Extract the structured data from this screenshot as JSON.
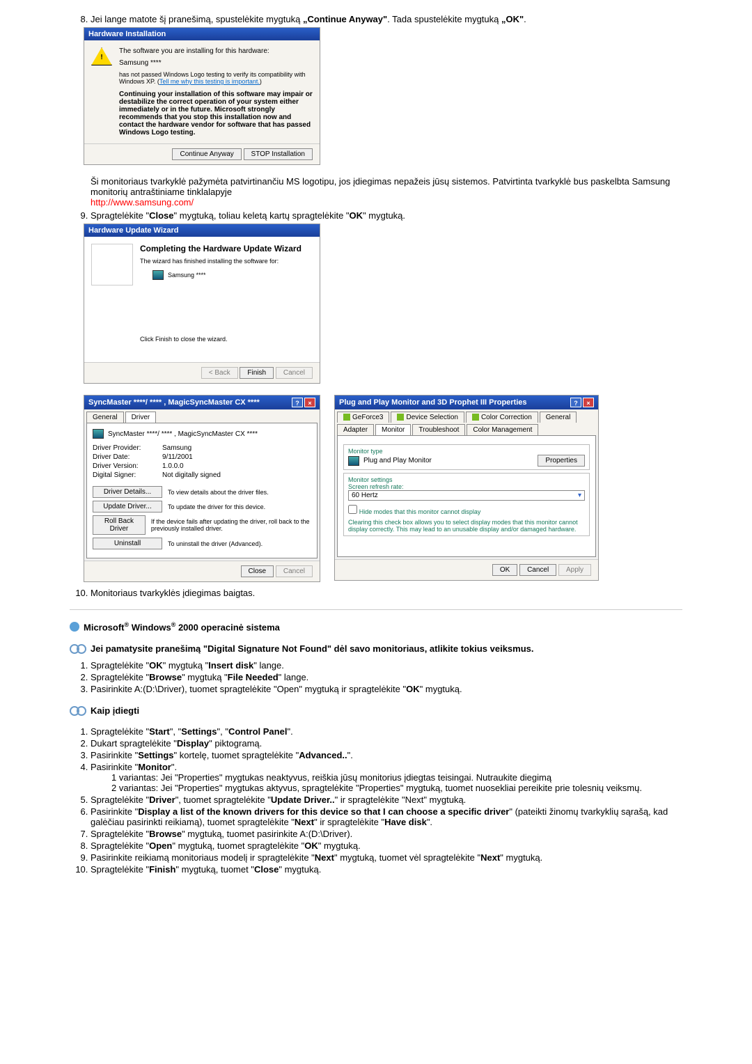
{
  "step8": {
    "num": "8.",
    "text_a": "Jei lange matote šį pranešimą, spustelėkite mygtuką ",
    "continue_anyway": "„Continue Anyway\"",
    "text_b": ". Tada spustelėkite mygtuką ",
    "ok": "„OK\"",
    "dot": "."
  },
  "dlg1": {
    "title": "Hardware Installation",
    "line1": "The software you are installing for this hardware:",
    "device": "Samsung ****",
    "line2a": "has not passed Windows Logo testing to verify its compatibility with Windows XP. (",
    "tell_me": "Tell me why this testing is important.",
    "line2b": ")",
    "warn": "Continuing your installation of this software may impair or destabilize the correct operation of your system either immediately or in the future. Microsoft strongly recommends that you stop this installation now and contact the hardware vendor for software that has passed Windows Logo testing.",
    "btn_continue": "Continue Anyway",
    "btn_stop": "STOP Installation"
  },
  "para1": {
    "a": "Ši monitoriaus tvarkyklė pažymėta patvirtinančiu MS logotipu, jos įdiegimas nepažeis jūsų sistemos. Patvirtinta tvarkyklė bus paskelbta Samsung monitorių antraštiniame tinklalapyje",
    "link": "http://www.samsung.com/"
  },
  "step9": {
    "num": "9.",
    "a": "Spragtelėkite \"",
    "close": "Close",
    "b": "\" mygtuką, toliau keletą kartų spragtelėkite \"",
    "ok": "OK",
    "c": "\" mygtuką."
  },
  "dlg2": {
    "title": "Hardware Update Wizard",
    "h1": "Completing the Hardware Update Wizard",
    "t1": "The wizard has finished installing the software for:",
    "dev": "Samsung ****",
    "t2": "Click Finish to close the wizard.",
    "back": "< Back",
    "finish": "Finish",
    "cancel": "Cancel"
  },
  "dlg3": {
    "title": "SyncMaster ****/ **** , MagicSyncMaster CX ****",
    "tab_general": "General",
    "tab_driver": "Driver",
    "header": "SyncMaster ****/ **** , MagicSyncMaster CX ****",
    "provider_l": "Driver Provider:",
    "provider_v": "Samsung",
    "date_l": "Driver Date:",
    "date_v": "9/11/2001",
    "ver_l": "Driver Version:",
    "ver_v": "1.0.0.0",
    "sign_l": "Digital Signer:",
    "sign_v": "Not digitally signed",
    "b_details": "Driver Details...",
    "b_details_d": "To view details about the driver files.",
    "b_update": "Update Driver...",
    "b_update_d": "To update the driver for this device.",
    "b_roll": "Roll Back Driver",
    "b_roll_d": "If the device fails after updating the driver, roll back to the previously installed driver.",
    "b_unin": "Uninstall",
    "b_unin_d": "To uninstall the driver (Advanced).",
    "close": "Close",
    "cancel": "Cancel"
  },
  "dlg4": {
    "title": "Plug and Play Monitor and 3D Prophet III Properties",
    "tabs": {
      "gf3": "GeForce3",
      "devsel": "Device Selection",
      "cc": "Color Correction",
      "gen": "General",
      "adap": "Adapter",
      "mon": "Monitor",
      "trbl": "Troubleshoot",
      "cmgmt": "Color Management"
    },
    "montype": "Monitor type",
    "monname": "Plug and Play Monitor",
    "props": "Properties",
    "monset": "Monitor settings",
    "refresh_l": "Screen refresh rate:",
    "refresh_v": "60 Hertz",
    "hide": "Hide modes that this monitor cannot display",
    "hint": "Clearing this check box allows you to select display modes that this monitor cannot display correctly. This may lead to an unusable display and/or damaged hardware.",
    "ok": "OK",
    "cancel": "Cancel",
    "apply": "Apply"
  },
  "step10": {
    "num": "10.",
    "t": "Monitoriaus tvarkyklės įdiegimas baigtas."
  },
  "section2": {
    "title_a": "Microsoft",
    "title_b": " Windows",
    "title_c": " 2000 operacinė sistema",
    "reg": "®"
  },
  "subhead1": {
    "a": "Jei pamatysite pranešimą \"Digital Signature Not Found\" dėl savo monitoriaus, atlikite tokius veiksmus."
  },
  "list1": {
    "i1a": "Spragtelėkite \"",
    "i1b": "OK",
    "i1c": "\" mygtuką \"",
    "i1d": "Insert disk",
    "i1e": "\" lange.",
    "i2a": "Spragtelėkite \"",
    "i2b": "Browse",
    "i2c": "\" mygtuką \"",
    "i2d": "File Needed",
    "i2e": "\" lange.",
    "i3a": "Pasirinkite A:(D:\\Driver), tuomet spragtelėkite \"Open\" mygtuką ir spragtelėkite \"",
    "i3b": "OK",
    "i3c": "\" mygtuką."
  },
  "subhead2": "Kaip įdiegti",
  "list2": {
    "i1a": "Spragtelėkite \"",
    "i1b": "Start",
    "i1c": "\", \"",
    "i1d": "Settings",
    "i1e": "\", \"",
    "i1f": "Control Panel",
    "i1g": "\".",
    "i2a": "Dukart spragtelėkite \"",
    "i2b": "Display",
    "i2c": "\" piktogramą.",
    "i3a": "Pasirinkite \"",
    "i3b": "Settings",
    "i3c": "\" kortelę, tuomet spragtelėkite \"",
    "i3d": "Advanced..",
    "i3e": "\".",
    "i4a": "Pasirinkite \"",
    "i4b": "Monitor",
    "i4c": "\".",
    "i4v1a": "1 variantas:",
    "i4v1b": "Jei \"Properties\" mygtukas neaktyvus, reiškia jūsų monitorius įdiegtas teisingai. Nutraukite diegimą",
    "i4v2a": "2 variantas:",
    "i4v2b": "Jei \"Properties\" mygtukas aktyvus, spragtelėkite \"Properties\" mygtuką, tuomet nuosekliai pereikite prie tolesnių veiksmų.",
    "i5a": "Spragtelėkite \"",
    "i5b": "Driver",
    "i5c": "\", tuomet spragtelėkite \"",
    "i5d": "Update Driver..",
    "i5e": "\" ir spragtelėkite \"Next\" mygtuką.",
    "i6a": "Pasirinkite \"",
    "i6b": "Display a list of the known drivers for this device so that I can choose a specific driver",
    "i6c": "\" (pateikti žinomų tvarkyklių sąrašą, kad galėčiau pasirinkti reikiamą), tuomet spragtelėkite \"",
    "i6d": "Next",
    "i6e": "\" ir spragtelėkite \"",
    "i6f": "Have disk",
    "i6g": "\".",
    "i7a": "Spragtelėkite \"",
    "i7b": "Browse",
    "i7c": "\" mygtuką, tuomet pasirinkite A:(D:\\Driver).",
    "i8a": "Spragtelėkite \"",
    "i8b": "Open",
    "i8c": "\" mygtuką, tuomet spragtelėkite \"",
    "i8d": "OK",
    "i8e": "\" mygtuką.",
    "i9a": "Pasirinkite reikiamą monitoriaus modelį ir spragtelėkite \"",
    "i9b": "Next",
    "i9c": "\" mygtuką, tuomet vėl spragtelėkite \"",
    "i9d": "Next",
    "i9e": "\" mygtuką.",
    "i10a": "Spragtelėkite \"",
    "i10b": "Finish",
    "i10c": "\" mygtuką, tuomet \"",
    "i10d": "Close",
    "i10e": "\" mygtuką."
  }
}
